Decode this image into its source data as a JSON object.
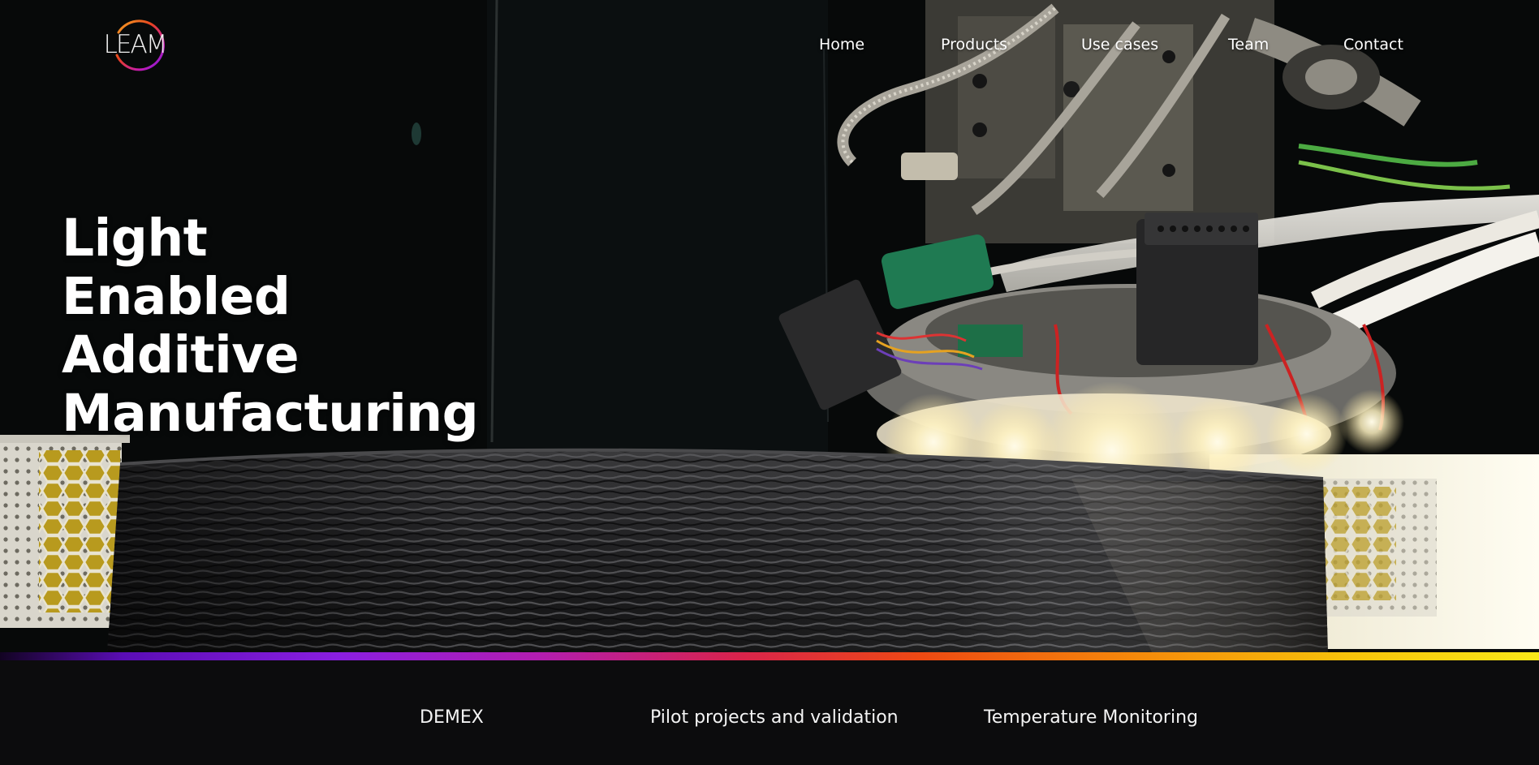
{
  "brand": {
    "logo_text": "LEAM"
  },
  "nav": {
    "items": [
      "Home",
      "Products",
      "Use cases",
      "Team",
      "Contact"
    ]
  },
  "hero": {
    "headline_lines": [
      "Light",
      "Enabled",
      "Additive",
      "Manufacturing"
    ],
    "image_description_icon": "3d-printer-head-photo"
  },
  "bottom_links": [
    "DEMEX",
    "Pilot projects and validation",
    "Temperature Monitoring"
  ],
  "colors": {
    "background": "#0b0b0c",
    "text": "#ffffff",
    "gradient_start": "#5a0db5",
    "gradient_mid": "#d8234c",
    "gradient_end": "#f9e818"
  }
}
